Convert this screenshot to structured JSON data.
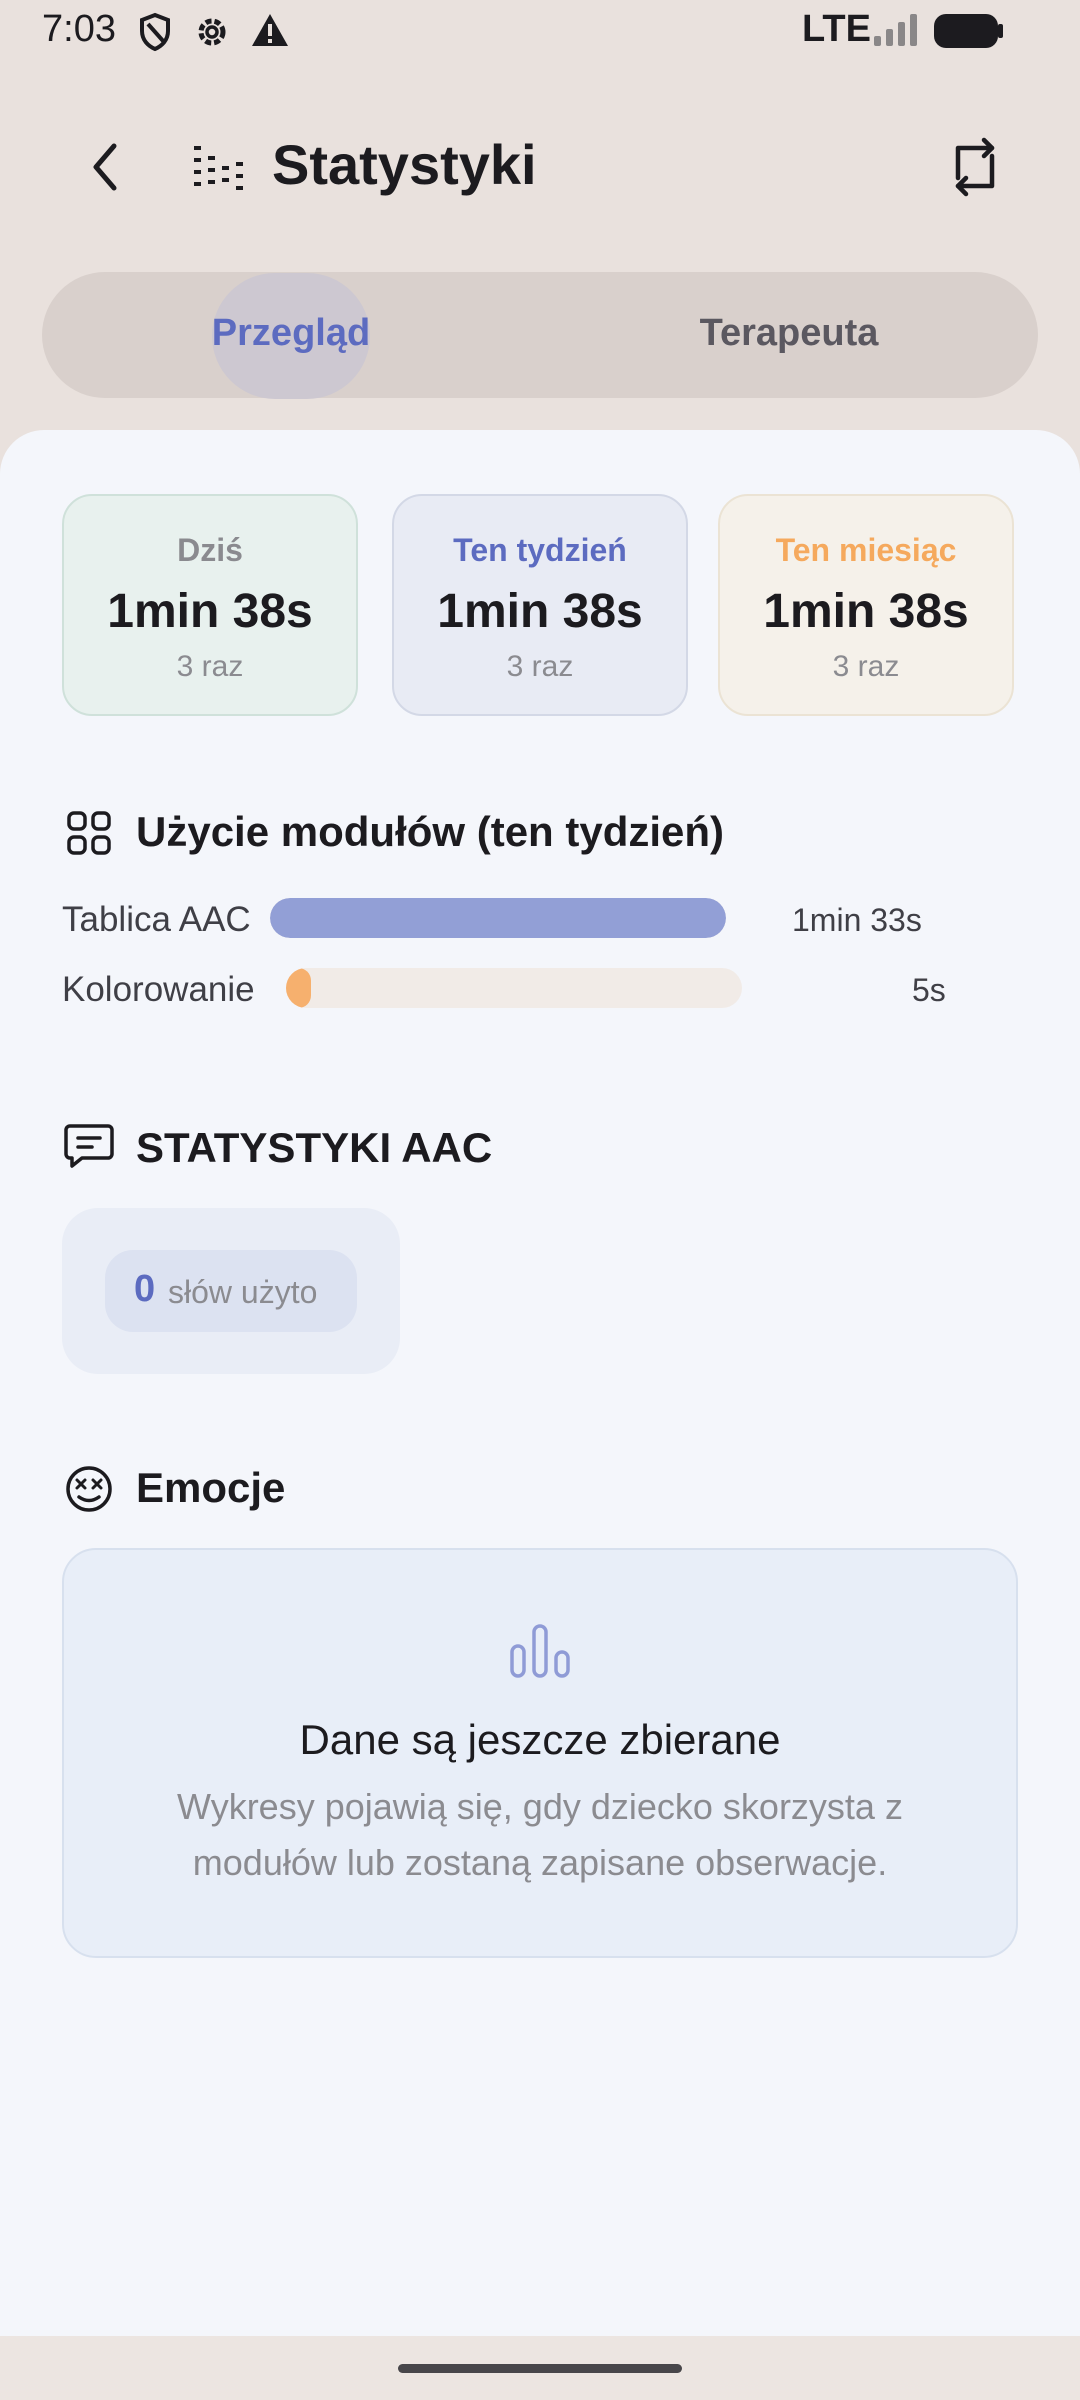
{
  "status_bar": {
    "time": "7:03",
    "network": "LTE",
    "icons": [
      "shield-icon",
      "gear-icon",
      "warning-icon",
      "signal-icon",
      "battery-icon"
    ]
  },
  "header": {
    "title": "Statystyki",
    "icons": [
      "back-arrow-icon",
      "stats-list-icon",
      "refresh-icon"
    ]
  },
  "tabs": [
    {
      "label": "Przegląd",
      "selected": true
    },
    {
      "label": "Terapeuta",
      "selected": false
    }
  ],
  "summary_cards": [
    {
      "label": "Dziś",
      "value": "1min 38s",
      "sub": "3 raz",
      "accent": "#8a8a8f",
      "bg": "#e8f1ee"
    },
    {
      "label": "Ten tydzień",
      "value": "1min 38s",
      "sub": "3 raz",
      "accent": "#5c6bc0",
      "bg": "#e8ebf4"
    },
    {
      "label": "Ten miesiąc",
      "value": "1min 38s",
      "sub": "3 raz",
      "accent": "#f5a95d",
      "bg": "#f5f1ea"
    }
  ],
  "module_usage": {
    "title": "Użycie modułów (ten tydzień)",
    "icon": "grid-icon",
    "rows": [
      {
        "label": "Tablica AAC",
        "value": "1min 33s",
        "fraction": 1.0,
        "color": "#929fd6"
      },
      {
        "label": "Kolorowanie",
        "value": "5s",
        "fraction": 0.054,
        "color": "#f6b06e"
      }
    ]
  },
  "aac_stats": {
    "title": "STATYSTYKI AAC",
    "icon": "chat-icon",
    "count": "0",
    "count_label": "słów użyto"
  },
  "emotions": {
    "title": "Emocje",
    "icon": "face-icon",
    "empty_icon": "bar-chart-icon",
    "empty_title": "Dane są jeszcze zbierane",
    "empty_line1": "Wykresy pojawią się, gdy dziecko skorzysta z",
    "empty_line2": "modułów lub zostaną zapisane obserwacje."
  }
}
